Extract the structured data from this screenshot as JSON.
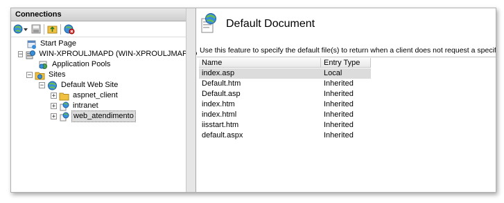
{
  "connections": {
    "header": "Connections",
    "toolbar": {
      "connect_icon": "globe-connect-icon",
      "save_icon": "save-icon",
      "up_icon": "up-folder-icon",
      "disconnect_icon": "disconnect-icon"
    },
    "tree": [
      {
        "label": "Start Page",
        "expander": "",
        "icon": "start-page-icon",
        "level": 1
      },
      {
        "label": "WIN-XPROULJMAPD (WIN-XPROULJMAPD\\Adminis",
        "expander": "−",
        "icon": "server-icon",
        "level": 1
      },
      {
        "label": "Application Pools",
        "expander": "",
        "icon": "app-pools-icon",
        "level": 2
      },
      {
        "label": "Sites",
        "expander": "−",
        "icon": "sites-folder-icon",
        "level": 2
      },
      {
        "label": "Default Web Site",
        "expander": "−",
        "icon": "website-globe-icon",
        "level": 3
      },
      {
        "label": "aspnet_client",
        "expander": "+",
        "icon": "folder-icon",
        "level": 4
      },
      {
        "label": "intranet",
        "expander": "+",
        "icon": "application-icon",
        "level": 4
      },
      {
        "label": "web_atendimento",
        "expander": "+",
        "icon": "application-icon",
        "level": 4,
        "selected": true
      }
    ]
  },
  "feature": {
    "title": "Default Document",
    "description": "Use this feature to specify the default file(s) to return when a client does not request a specific file.",
    "columns": [
      "Name",
      "Entry Type"
    ],
    "rows": [
      {
        "name": "index.asp",
        "entry_type": "Local",
        "selected": true
      },
      {
        "name": "Default.htm",
        "entry_type": "Inherited"
      },
      {
        "name": "Default.asp",
        "entry_type": "Inherited"
      },
      {
        "name": "index.htm",
        "entry_type": "Inherited"
      },
      {
        "name": "index.html",
        "entry_type": "Inherited"
      },
      {
        "name": "iisstart.htm",
        "entry_type": "Inherited"
      },
      {
        "name": "default.aspx",
        "entry_type": "Inherited"
      }
    ]
  }
}
